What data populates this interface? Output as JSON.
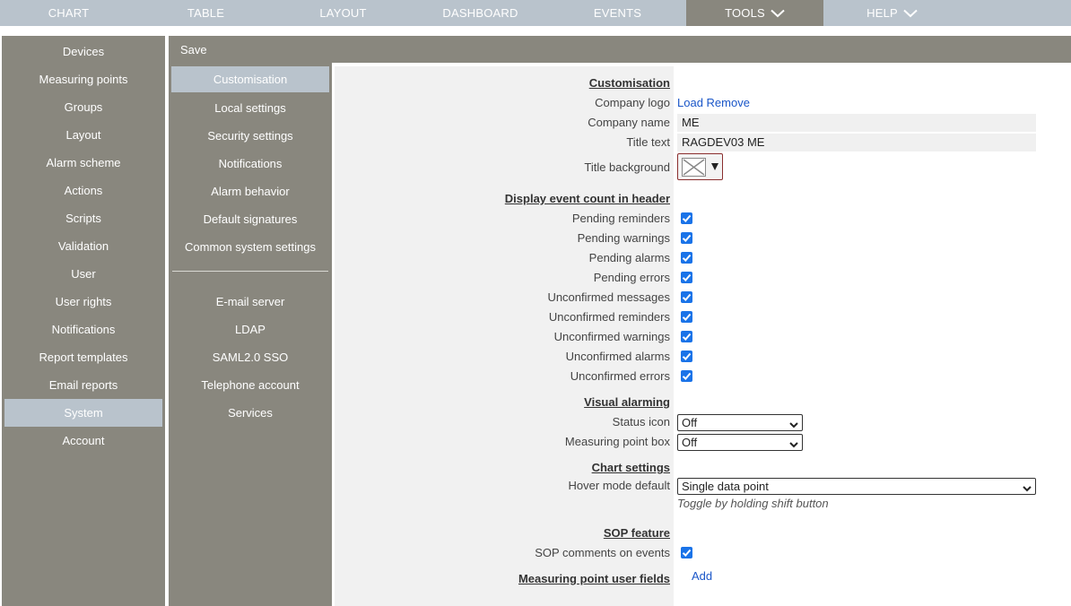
{
  "topnav": [
    {
      "label": "CHART",
      "active": false,
      "chevron": false
    },
    {
      "label": "TABLE",
      "active": false,
      "chevron": false
    },
    {
      "label": "LAYOUT",
      "active": false,
      "chevron": false
    },
    {
      "label": "DASHBOARD",
      "active": false,
      "chevron": false
    },
    {
      "label": "EVENTS",
      "active": false,
      "chevron": false
    },
    {
      "label": "TOOLS",
      "active": true,
      "chevron": true
    },
    {
      "label": "HELP",
      "active": false,
      "chevron": true
    }
  ],
  "sidebar": {
    "items": [
      "Devices",
      "Measuring points",
      "Groups",
      "Layout",
      "Alarm scheme",
      "Actions",
      "Scripts",
      "Validation",
      "User",
      "User rights",
      "Notifications",
      "Report templates",
      "Email reports",
      "System",
      "Account"
    ],
    "active_index": 13
  },
  "savebar": {
    "save_label": "Save"
  },
  "submenu": {
    "group1": [
      "Customisation",
      "Local settings",
      "Security settings",
      "Notifications",
      "Alarm behavior",
      "Default signatures",
      "Common system settings"
    ],
    "group2": [
      "E-mail server",
      "LDAP",
      "SAML2.0 SSO",
      "Telephone account",
      "Services"
    ],
    "active": "Customisation"
  },
  "form": {
    "customisation_heading": "Customisation",
    "company_logo_label": "Company logo",
    "logo_load": "Load",
    "logo_remove": "Remove",
    "company_name_label": "Company name",
    "company_name_value": "ME",
    "title_text_label": "Title text",
    "title_text_value": "RAGDEV03 ME",
    "title_background_label": "Title background",
    "title_background_icon": "no-color-icon",
    "event_count_heading": "Display event count in header",
    "event_checks": [
      {
        "label": "Pending reminders",
        "checked": true
      },
      {
        "label": "Pending warnings",
        "checked": true
      },
      {
        "label": "Pending alarms",
        "checked": true
      },
      {
        "label": "Pending errors",
        "checked": true
      },
      {
        "label": "Unconfirmed messages",
        "checked": true
      },
      {
        "label": "Unconfirmed reminders",
        "checked": true
      },
      {
        "label": "Unconfirmed warnings",
        "checked": true
      },
      {
        "label": "Unconfirmed alarms",
        "checked": true
      },
      {
        "label": "Unconfirmed errors",
        "checked": true
      }
    ],
    "visual_alarming_heading": "Visual alarming",
    "status_icon_label": "Status icon",
    "status_icon_value": "Off",
    "mp_box_label": "Measuring point box",
    "mp_box_value": "Off",
    "chart_settings_heading": "Chart settings",
    "hover_mode_label": "Hover mode default",
    "hover_mode_value": "Single data point",
    "hover_hint": "Toggle by holding shift button",
    "sop_heading": "SOP feature",
    "sop_comments_label": "SOP comments on events",
    "sop_comments_checked": true,
    "mp_user_fields_heading": "Measuring point user fields",
    "mp_user_fields_add": "Add"
  },
  "colors": {
    "nav_bg": "#b9c3cc",
    "panel_bg": "#89877e",
    "checkbox": "#1a73e8",
    "link": "#1a56c8"
  }
}
